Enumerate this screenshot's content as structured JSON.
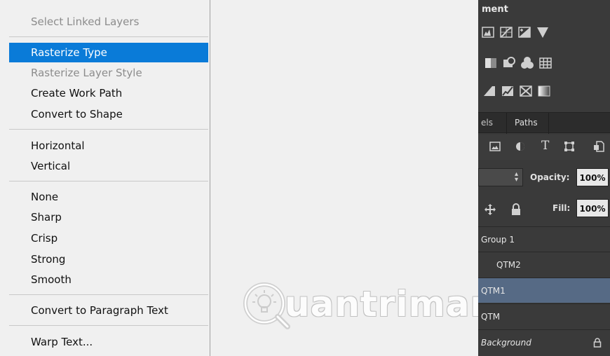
{
  "context_menu": {
    "items": [
      {
        "label": "Select Linked Layers",
        "disabled": true
      },
      {
        "label": "Rasterize Type",
        "highlighted": true
      },
      {
        "label": "Rasterize Layer Style",
        "disabled": true
      },
      {
        "label": "Create Work Path"
      },
      {
        "label": "Convert to Shape"
      },
      {
        "label": "Horizontal"
      },
      {
        "label": "Vertical"
      },
      {
        "label": "None"
      },
      {
        "label": "Sharp"
      },
      {
        "label": "Crisp"
      },
      {
        "label": "Strong"
      },
      {
        "label": "Smooth"
      },
      {
        "label": "Convert to Paragraph Text"
      },
      {
        "label": "Warp Text..."
      }
    ],
    "highlight_color": "#0a7bd8"
  },
  "watermark": {
    "text": "uantrimang"
  },
  "panel": {
    "adjustments_title": "ment",
    "tabs": [
      "els",
      "Paths"
    ],
    "filter_icons": [
      "image-icon",
      "adjustment-circle-icon",
      "type-icon",
      "shape-icon",
      "smart-object-icon"
    ],
    "opacity_label": "Opacity:",
    "opacity_value": "100%",
    "fill_label": "Fill:",
    "fill_value": "100%",
    "layers": [
      {
        "name": "Group 1",
        "type": "group"
      },
      {
        "name": "QTM2"
      },
      {
        "name": "QTM1",
        "selected": true
      },
      {
        "name": "QTM"
      },
      {
        "name": "Background",
        "locked": true
      }
    ],
    "selected_color": "#566a85"
  }
}
